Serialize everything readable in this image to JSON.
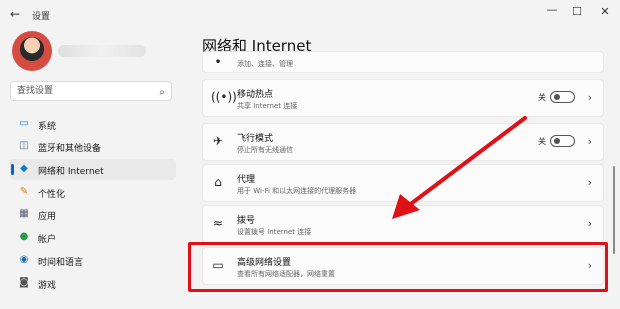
{
  "window": {
    "title": "设置",
    "minimize": "—",
    "maximize": "☐",
    "close": "✕"
  },
  "sidebar": {
    "search_placeholder": "查找设置",
    "items": [
      {
        "label": "系统",
        "icon": "system-icon"
      },
      {
        "label": "蓝牙和其他设备",
        "icon": "bluetooth-icon"
      },
      {
        "label": "网络和 Internet",
        "icon": "wifi-icon",
        "active": true
      },
      {
        "label": "个性化",
        "icon": "brush-icon"
      },
      {
        "label": "应用",
        "icon": "apps-icon"
      },
      {
        "label": "帐户",
        "icon": "account-icon"
      },
      {
        "label": "时间和语言",
        "icon": "globe-icon"
      },
      {
        "label": "游戏",
        "icon": "game-icon"
      }
    ]
  },
  "main": {
    "title": "网络和 Internet",
    "cards": [
      {
        "title": "",
        "sub": "添加、连接、管理",
        "icon": "",
        "control": "chevron"
      },
      {
        "title": "移动热点",
        "sub": "共享 Internet 连接",
        "icon": "hotspot-icon",
        "control": "toggle",
        "state": "关"
      },
      {
        "title": "飞行模式",
        "sub": "停止所有无线通信",
        "icon": "airplane-icon",
        "control": "toggle",
        "state": "关"
      },
      {
        "title": "代理",
        "sub": "用于 Wi-Fi 和以太网连接的代理服务器",
        "icon": "proxy-icon",
        "control": "chevron"
      },
      {
        "title": "拨号",
        "sub": "设置拨号 Internet 连接",
        "icon": "dialup-icon",
        "control": "chevron"
      },
      {
        "title": "高级网络设置",
        "sub": "查看所有网络适配器，网络重置",
        "icon": "advanced-network-icon",
        "control": "chevron"
      }
    ]
  },
  "colors": {
    "accent": "#0067c0",
    "highlight": "#e10f16"
  }
}
